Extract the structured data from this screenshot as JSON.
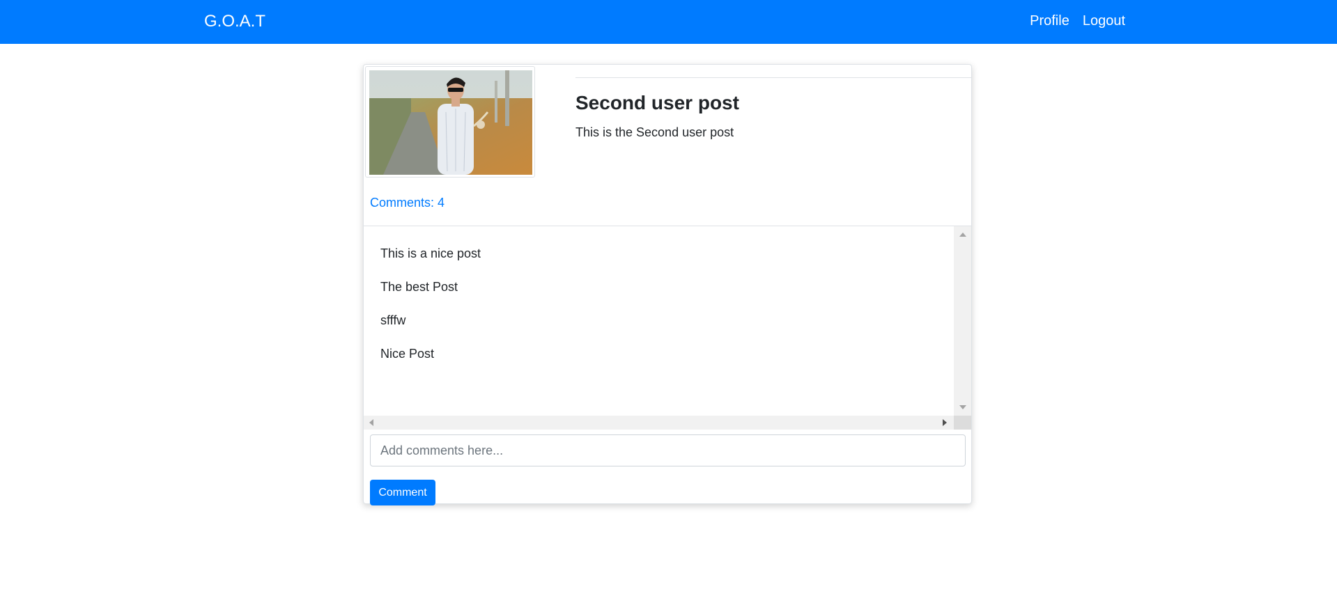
{
  "navbar": {
    "brand": "G.O.A.T",
    "links": [
      "Profile",
      "Logout"
    ],
    "background_color": "#007bff"
  },
  "post": {
    "title": "Second user post",
    "body": "This is the Second user post",
    "image_icon": "user-photo"
  },
  "comments": {
    "count_label": "Comments: 4",
    "items": [
      "This is a nice post",
      "The best Post",
      "sfffw",
      "Nice Post"
    ],
    "input_placeholder": "Add comments here...",
    "submit_label": "Comment"
  },
  "colors": {
    "accent": "#007bff",
    "text": "#212529"
  }
}
